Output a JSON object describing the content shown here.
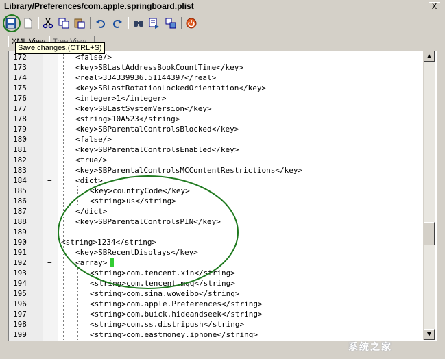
{
  "window": {
    "title": "Library/Preferences/com.apple.springboard.plist",
    "close_label": "X"
  },
  "toolbar": {
    "buttons": [
      {
        "icon": "save-icon"
      },
      {
        "icon": "new-icon"
      },
      {
        "icon": "cut-icon"
      },
      {
        "icon": "copy-icon"
      },
      {
        "icon": "paste-icon"
      },
      {
        "icon": "undo-icon"
      },
      {
        "icon": "redo-icon"
      },
      {
        "icon": "find-icon"
      },
      {
        "icon": "find-next-icon"
      },
      {
        "icon": "replace-icon"
      },
      {
        "icon": "exit-icon"
      }
    ],
    "tooltip": "Save changes.(CTRL+S)"
  },
  "tabs": [
    {
      "label": "XML View"
    },
    {
      "label": "Tree View"
    }
  ],
  "editor": {
    "lines": [
      {
        "num": "172",
        "fold": "",
        "indent": 2,
        "text": "<false/>"
      },
      {
        "num": "173",
        "fold": "",
        "indent": 2,
        "text": "<key>SBLastAddressBookCountTime</key>"
      },
      {
        "num": "174",
        "fold": "",
        "indent": 2,
        "text": "<real>334339936.51144397</real>"
      },
      {
        "num": "175",
        "fold": "",
        "indent": 2,
        "text": "<key>SBLastRotationLockedOrientation</key>"
      },
      {
        "num": "176",
        "fold": "",
        "indent": 2,
        "text": "<integer>1</integer>"
      },
      {
        "num": "177",
        "fold": "",
        "indent": 2,
        "text": "<key>SBLastSystemVersion</key>"
      },
      {
        "num": "178",
        "fold": "",
        "indent": 2,
        "text": "<string>10A523</string>"
      },
      {
        "num": "179",
        "fold": "",
        "indent": 2,
        "text": "<key>SBParentalControlsBlocked</key>"
      },
      {
        "num": "180",
        "fold": "",
        "indent": 2,
        "text": "<false/>"
      },
      {
        "num": "181",
        "fold": "",
        "indent": 2,
        "text": "<key>SBParentalControlsEnabled</key>"
      },
      {
        "num": "182",
        "fold": "",
        "indent": 2,
        "text": "<true/>"
      },
      {
        "num": "183",
        "fold": "",
        "indent": 2,
        "text": "<key>SBParentalControlsMCContentRestrictions</key>"
      },
      {
        "num": "184",
        "fold": "−",
        "indent": 2,
        "text": "<dict>"
      },
      {
        "num": "185",
        "fold": "",
        "indent": 3,
        "text": "<key>countryCode</key>"
      },
      {
        "num": "186",
        "fold": "",
        "indent": 3,
        "text": "<string>us</string>"
      },
      {
        "num": "187",
        "fold": "",
        "indent": 2,
        "text": "</dict>"
      },
      {
        "num": "188",
        "fold": "",
        "indent": 2,
        "text": "<key>SBParentalControlsPIN</key>"
      },
      {
        "num": "189",
        "fold": "",
        "indent": 0,
        "text": ""
      },
      {
        "num": "190",
        "fold": "",
        "indent": 0,
        "text": "<string>1234</string>"
      },
      {
        "num": "191",
        "fold": "",
        "indent": 2,
        "text": "<key>SBRecentDisplays</key>"
      },
      {
        "num": "192",
        "fold": "−",
        "indent": 2,
        "text": "<array>"
      },
      {
        "num": "193",
        "fold": "",
        "indent": 3,
        "text": "<string>com.tencent.xin</string>"
      },
      {
        "num": "194",
        "fold": "",
        "indent": 3,
        "text": "<string>com.tencent.mqq</string>"
      },
      {
        "num": "195",
        "fold": "",
        "indent": 3,
        "text": "<string>com.sina.woweibo</string>"
      },
      {
        "num": "196",
        "fold": "",
        "indent": 3,
        "text": "<string>com.apple.Preferences</string>"
      },
      {
        "num": "197",
        "fold": "",
        "indent": 3,
        "text": "<string>com.buick.hideandseek</string>"
      },
      {
        "num": "198",
        "fold": "",
        "indent": 3,
        "text": "<string>com.ss.distripush</string>"
      },
      {
        "num": "199",
        "fold": "",
        "indent": 3,
        "text": "<string>com.eastmoney.iphone</string>"
      }
    ]
  },
  "scrollbar": {
    "up_arrow": "▲",
    "down_arrow": "▼"
  },
  "watermark": "系统之家"
}
